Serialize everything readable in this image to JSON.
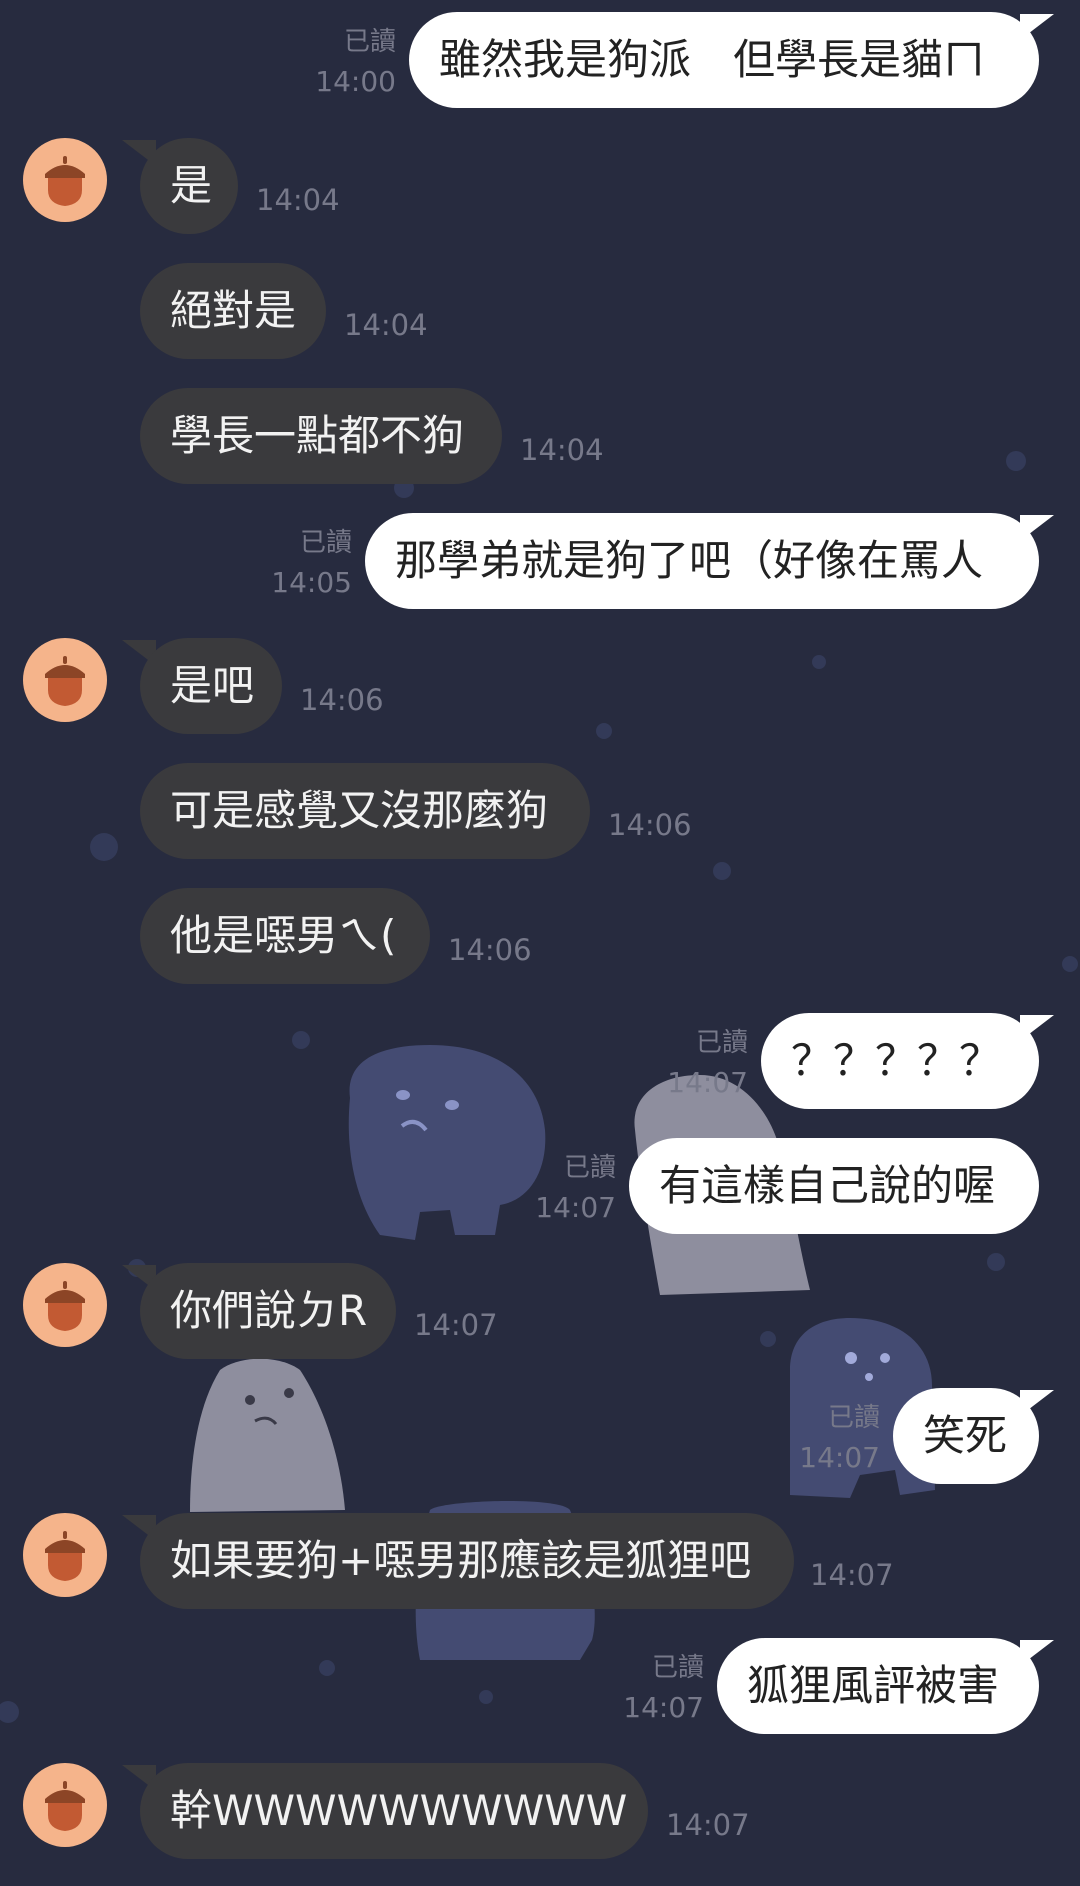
{
  "colors": {
    "background": "#272b3f",
    "incoming_bubble": "#3a3a3d",
    "outgoing_bubble": "#ffffff",
    "timestamp": "#77798a",
    "avatar_bg": "#f5b48b",
    "avatar_icon": "#a6532b"
  },
  "avatar_icon": "acorn-icon",
  "messages": [
    {
      "id": 1,
      "side": "out",
      "text": "雖然我是狗派　但學長是貓ㄇ",
      "read": "已讀",
      "time": "14:00"
    },
    {
      "id": 2,
      "side": "in",
      "text": "是",
      "time": "14:04",
      "avatar": true
    },
    {
      "id": 3,
      "side": "in",
      "text": "絕對是",
      "time": "14:04"
    },
    {
      "id": 4,
      "side": "in",
      "text": "學長一點都不狗",
      "time": "14:04"
    },
    {
      "id": 5,
      "side": "out",
      "text": "那學弟就是狗了吧（好像在罵人",
      "read": "已讀",
      "time": "14:05"
    },
    {
      "id": 6,
      "side": "in",
      "text": "是吧",
      "time": "14:06",
      "avatar": true
    },
    {
      "id": 7,
      "side": "in",
      "text": "可是感覺又沒那麼狗",
      "time": "14:06"
    },
    {
      "id": 8,
      "side": "in",
      "text": "他是噁男ㄟ(",
      "time": "14:06"
    },
    {
      "id": 9,
      "side": "out",
      "text": "？？？？？",
      "read": "已讀",
      "time": "14:07"
    },
    {
      "id": 10,
      "side": "out",
      "text": "有這樣自己說的喔",
      "read": "已讀",
      "time": "14:07"
    },
    {
      "id": 11,
      "side": "in",
      "text": "你們說ㄉR",
      "time": "14:07",
      "avatar": true
    },
    {
      "id": 12,
      "side": "out",
      "text": "笑死",
      "read": "已讀",
      "time": "14:07"
    },
    {
      "id": 13,
      "side": "in",
      "text": "如果要狗+噁男那應該是狐狸吧",
      "time": "14:07",
      "avatar": true
    },
    {
      "id": 14,
      "side": "out",
      "text": "狐狸風評被害",
      "read": "已讀",
      "time": "14:07"
    },
    {
      "id": 15,
      "side": "in",
      "text": "幹WWWWWWWWWW",
      "time": "14:07",
      "avatar": true
    }
  ]
}
